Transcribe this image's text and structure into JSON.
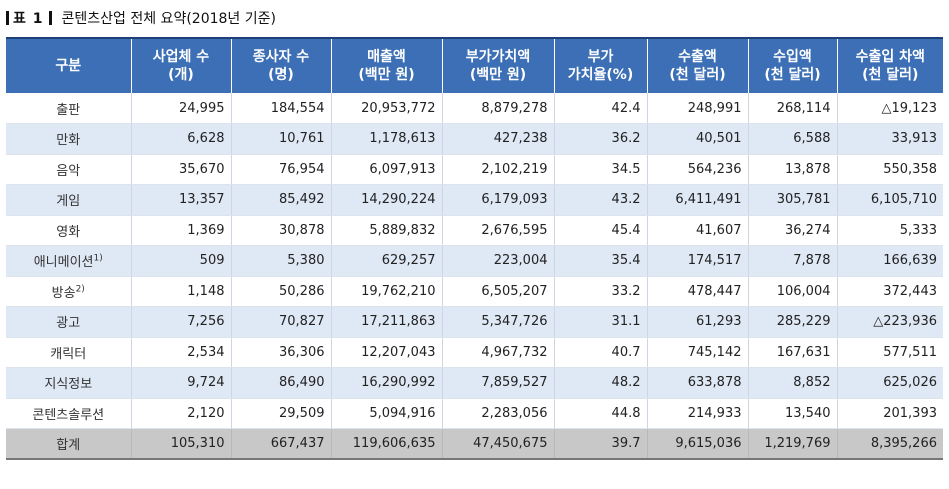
{
  "caption": {
    "label": "표 1",
    "title": "콘텐츠산업 전체 요약(2018년 기준)"
  },
  "table": {
    "headers": [
      {
        "l1": "구분",
        "l2": ""
      },
      {
        "l1": "사업체 수",
        "l2": "(개)"
      },
      {
        "l1": "종사자 수",
        "l2": "(명)"
      },
      {
        "l1": "매출액",
        "l2": "(백만 원)"
      },
      {
        "l1": "부가가치액",
        "l2": "(백만 원)"
      },
      {
        "l1": "부가",
        "l2": "가치율(%)"
      },
      {
        "l1": "수출액",
        "l2": "(천 달러)"
      },
      {
        "l1": "수입액",
        "l2": "(천 달러)"
      },
      {
        "l1": "수출입 차액",
        "l2": "(천 달러)"
      }
    ],
    "rows": [
      {
        "name": "출판",
        "sup": "",
        "values": [
          "24,995",
          "184,554",
          "20,953,772",
          "8,879,278",
          "42.4",
          "248,991",
          "268,114",
          "△19,123"
        ]
      },
      {
        "name": "만화",
        "sup": "",
        "values": [
          "6,628",
          "10,761",
          "1,178,613",
          "427,238",
          "36.2",
          "40,501",
          "6,588",
          "33,913"
        ]
      },
      {
        "name": "음악",
        "sup": "",
        "values": [
          "35,670",
          "76,954",
          "6,097,913",
          "2,102,219",
          "34.5",
          "564,236",
          "13,878",
          "550,358"
        ]
      },
      {
        "name": "게임",
        "sup": "",
        "values": [
          "13,357",
          "85,492",
          "14,290,224",
          "6,179,093",
          "43.2",
          "6,411,491",
          "305,781",
          "6,105,710"
        ]
      },
      {
        "name": "영화",
        "sup": "",
        "values": [
          "1,369",
          "30,878",
          "5,889,832",
          "2,676,595",
          "45.4",
          "41,607",
          "36,274",
          "5,333"
        ]
      },
      {
        "name": "애니메이션",
        "sup": "1)",
        "values": [
          "509",
          "5,380",
          "629,257",
          "223,004",
          "35.4",
          "174,517",
          "7,878",
          "166,639"
        ]
      },
      {
        "name": "방송",
        "sup": "2)",
        "values": [
          "1,148",
          "50,286",
          "19,762,210",
          "6,505,207",
          "33.2",
          "478,447",
          "106,004",
          "372,443"
        ]
      },
      {
        "name": "광고",
        "sup": "",
        "values": [
          "7,256",
          "70,827",
          "17,211,863",
          "5,347,726",
          "31.1",
          "61,293",
          "285,229",
          "△223,936"
        ]
      },
      {
        "name": "캐릭터",
        "sup": "",
        "values": [
          "2,534",
          "36,306",
          "12,207,043",
          "4,967,732",
          "40.7",
          "745,142",
          "167,631",
          "577,511"
        ]
      },
      {
        "name": "지식정보",
        "sup": "",
        "values": [
          "9,724",
          "86,490",
          "16,290,992",
          "7,859,527",
          "48.2",
          "633,878",
          "8,852",
          "625,026"
        ]
      },
      {
        "name": "콘텐츠솔루션",
        "sup": "",
        "values": [
          "2,120",
          "29,509",
          "5,094,916",
          "2,283,056",
          "44.8",
          "214,933",
          "13,540",
          "201,393"
        ]
      }
    ],
    "total": {
      "name": "합계",
      "values": [
        "105,310",
        "667,437",
        "119,606,635",
        "47,450,675",
        "39.7",
        "9,615,036",
        "1,219,769",
        "8,395,266"
      ]
    }
  }
}
